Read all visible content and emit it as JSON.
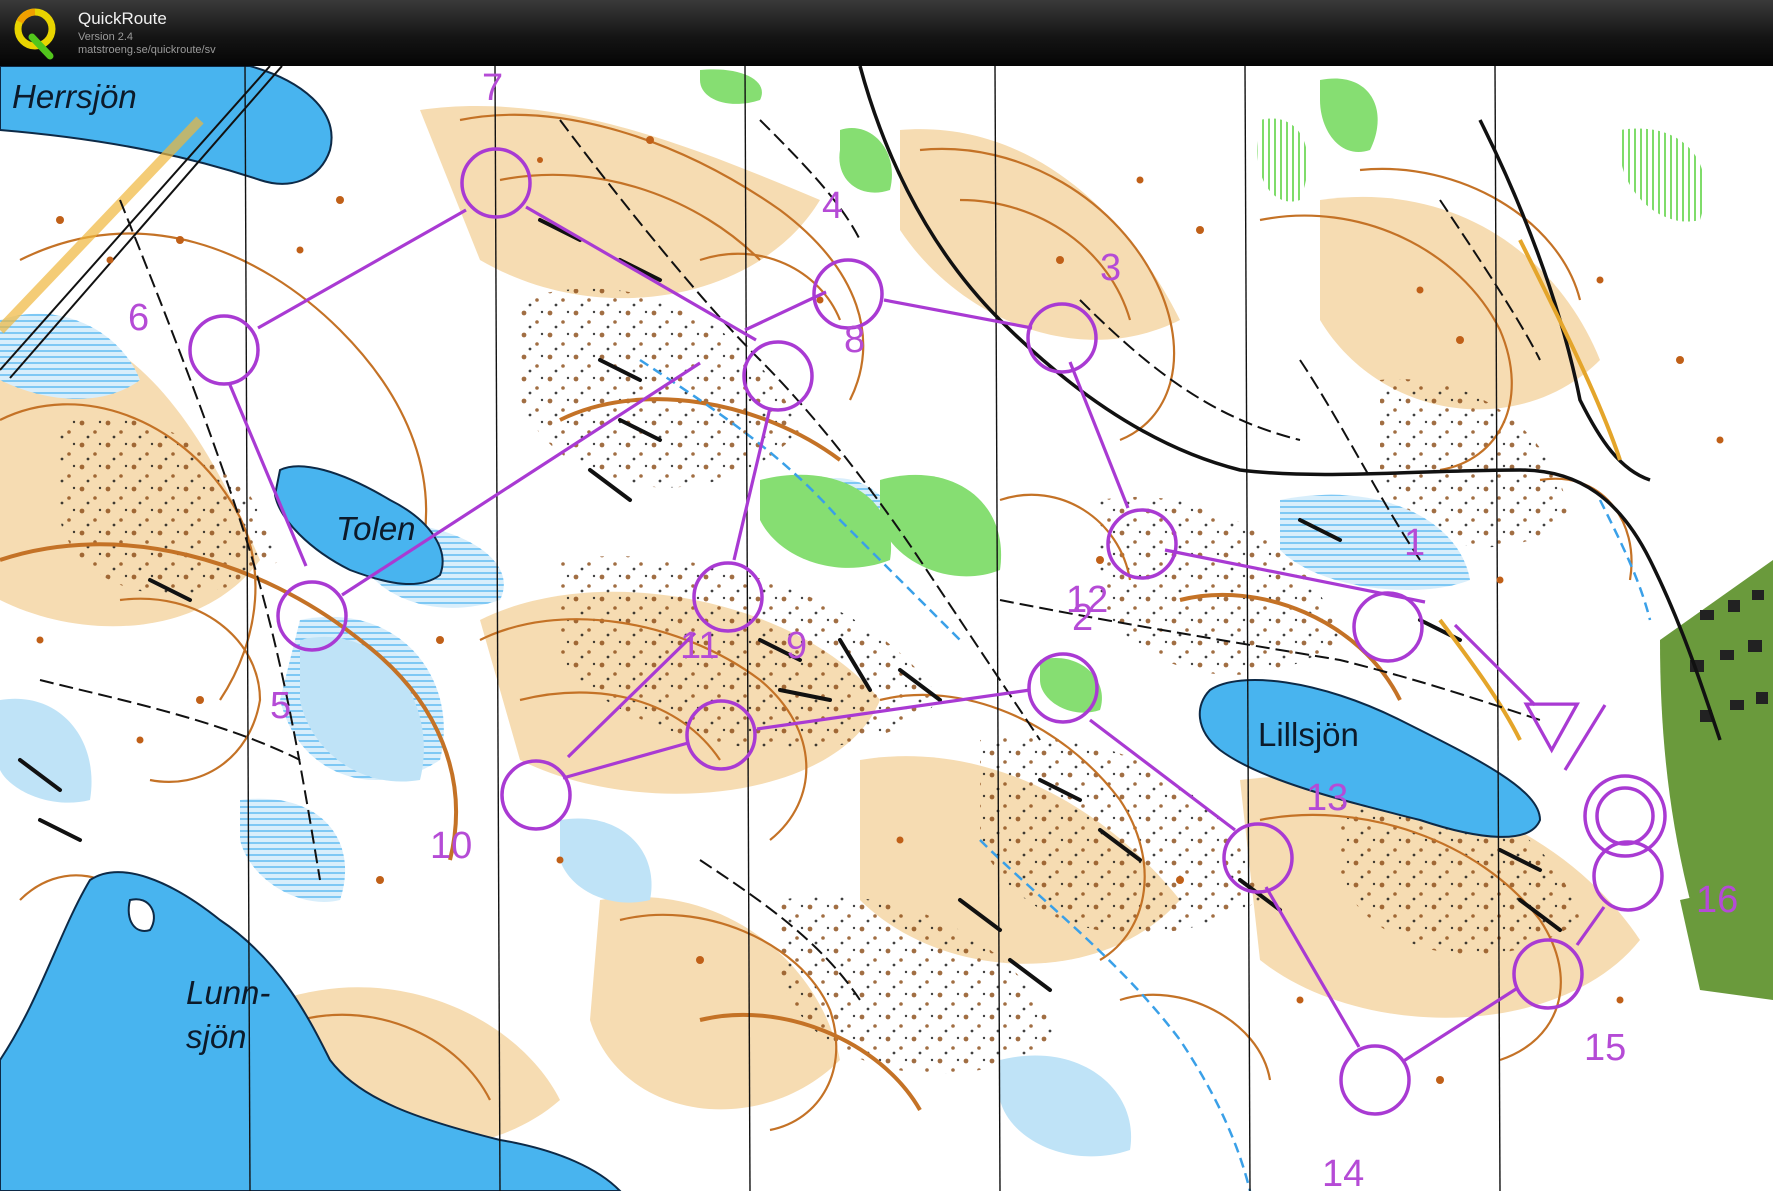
{
  "app": {
    "name": "QuickRoute",
    "version": "Version 2.4",
    "url": "matstroeng.se/quickroute/sv"
  },
  "colors": {
    "course": "#a93ad3",
    "water": "#48b4ef",
    "forest_green": "#7fdc6a",
    "contour": "#c47226",
    "open_land": "#f5d9ae",
    "marsh": "#b2dcf5"
  },
  "lakes": [
    {
      "id": "herrsjon",
      "name": "Herrsjön"
    },
    {
      "id": "tolen",
      "name": "Tolen"
    },
    {
      "id": "lillsjon",
      "name": "Lillsjön"
    },
    {
      "id": "lunnsjon",
      "name": "Lunn-\nsjön",
      "line1": "Lunn-",
      "line2": "sjön"
    }
  ],
  "course": {
    "start_symbol": "triangle",
    "finish_symbol": "double-circle",
    "control_labels": [
      "1",
      "2",
      "3",
      "4",
      "5",
      "6",
      "7",
      "8",
      "9",
      "10",
      "11",
      "12",
      "13",
      "14",
      "15",
      "16"
    ]
  }
}
